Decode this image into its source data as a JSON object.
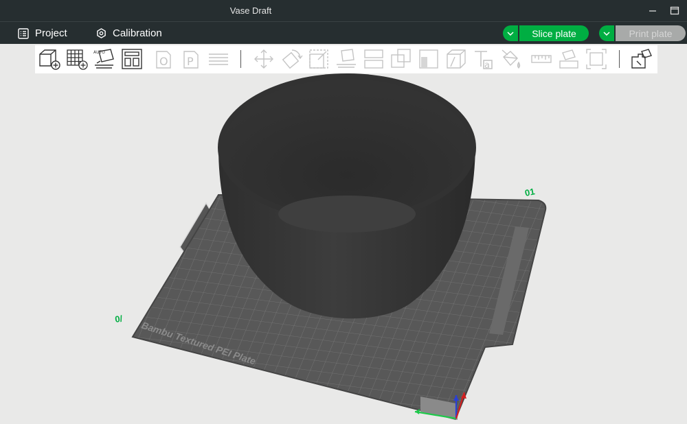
{
  "window": {
    "title": "Vase Draft"
  },
  "menu": {
    "project": "Project",
    "calibration": "Calibration"
  },
  "actions": {
    "slice": "Slice plate",
    "print": "Print plate"
  },
  "plate": {
    "label": "Bambu Textured PEI Plate",
    "corner_top": "01",
    "corner_left": "0/"
  },
  "colors": {
    "accent": "#00ae42",
    "titlebar": "#262e30",
    "viewport": "#e9e9e8",
    "plate": "#555555",
    "model": "#3a3a3a"
  },
  "toolbar_icons": [
    "add-object-icon",
    "add-plate-icon",
    "auto-orient-icon",
    "arrange-icon",
    "split-objects-icon",
    "split-parts-icon",
    "layers-icon",
    "move-icon",
    "rotate-icon",
    "scale-icon",
    "lay-on-face-icon",
    "cut-icon",
    "boolean-icon",
    "support-paint-icon",
    "seam-paint-icon",
    "emboss-text-icon",
    "color-paint-icon",
    "measure-icon",
    "assembly-icon",
    "fit-view-icon",
    "variable-layer-icon"
  ]
}
